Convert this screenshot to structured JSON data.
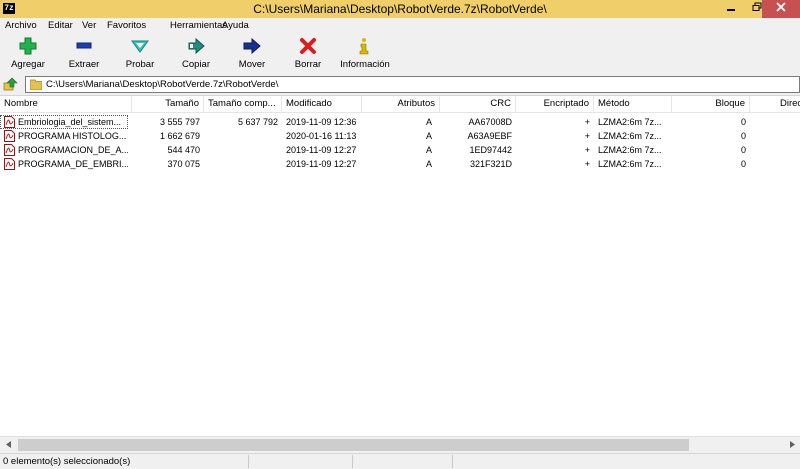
{
  "window": {
    "app_icon": "7z",
    "title": "C:\\Users\\Mariana\\Desktop\\RobotVerde.7z\\RobotVerde\\",
    "minimize_icon": "minimize-icon",
    "maximize_icon": "maximize-icon",
    "close_icon": "close-icon"
  },
  "menu": [
    "Archivo",
    "Editar",
    "Ver",
    "Favoritos",
    "Herramientas",
    "Ayuda"
  ],
  "toolbar": [
    {
      "label": "Agregar",
      "icon": "plus-icon",
      "color": "#22b14c"
    },
    {
      "label": "Extraer",
      "icon": "minus-icon",
      "color": "#1a3fb0"
    },
    {
      "label": "Probar",
      "icon": "chevron-down-icon",
      "color": "#33c3c3"
    },
    {
      "label": "Copiar",
      "icon": "copy-arrow-icon",
      "color": "#1f8f7a"
    },
    {
      "label": "Mover",
      "icon": "arrow-right-icon",
      "color": "#1a2f8f"
    },
    {
      "label": "Borrar",
      "icon": "x-icon",
      "color": "#d81e1e"
    },
    {
      "label": "Información",
      "icon": "info-icon",
      "color": "#d8b800"
    }
  ],
  "address": {
    "path": "C:\\Users\\Mariana\\Desktop\\RobotVerde.7z\\RobotVerde\\"
  },
  "columns": [
    "Nombre",
    "Tamaño",
    "Tamaño comp...",
    "Modificado",
    "Atributos",
    "CRC",
    "Encriptado",
    "Método",
    "Bloque",
    "Direc"
  ],
  "files": [
    {
      "name": "Embriologia_del_sistem...",
      "size": "3 555 797",
      "packed": "5 637 792",
      "modified": "2019-11-09 12:36",
      "attributes": "A",
      "crc": "AA67008D",
      "encrypted": "+",
      "method": "LZMA2:6m 7z...",
      "block": "0",
      "icon": "pdf-icon"
    },
    {
      "name": "PROGRAMA HISTOLOG...",
      "size": "1 662 679",
      "packed": "",
      "modified": "2020-01-16 11:13",
      "attributes": "A",
      "crc": "A63A9EBF",
      "encrypted": "+",
      "method": "LZMA2:6m 7z...",
      "block": "0",
      "icon": "pdf-icon"
    },
    {
      "name": "PROGRAMACION_DE_A...",
      "size": "544 470",
      "packed": "",
      "modified": "2019-11-09 12:27",
      "attributes": "A",
      "crc": "1ED97442",
      "encrypted": "+",
      "method": "LZMA2:6m 7z...",
      "block": "0",
      "icon": "pdf-icon"
    },
    {
      "name": "PROGRAMA_DE_EMBRI...",
      "size": "370 075",
      "packed": "",
      "modified": "2019-11-09 12:27",
      "attributes": "A",
      "crc": "321F321D",
      "encrypted": "+",
      "method": "LZMA2:6m 7z...",
      "block": "0",
      "icon": "pdf-icon"
    }
  ],
  "status": {
    "selection": "0 elemento(s) seleccionado(s)"
  }
}
